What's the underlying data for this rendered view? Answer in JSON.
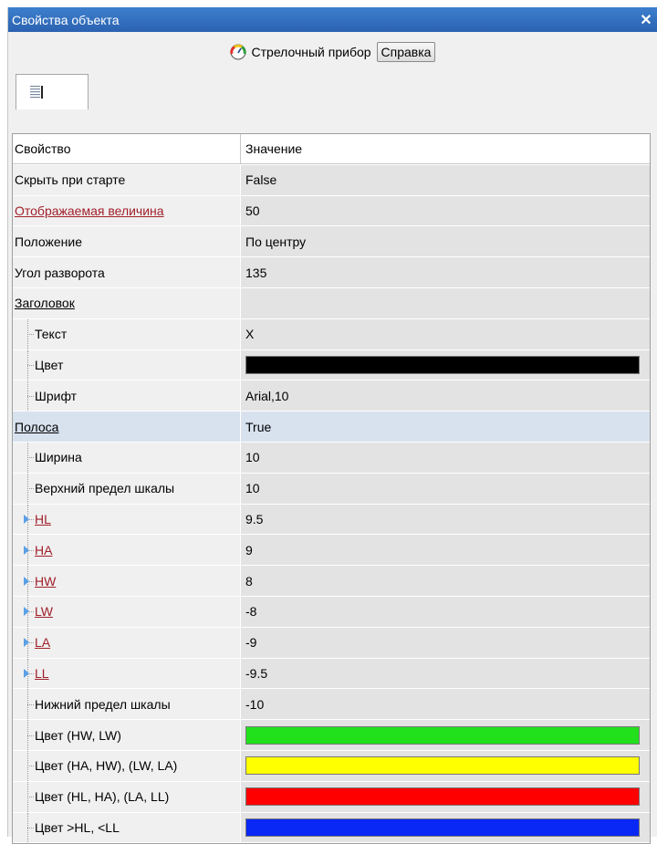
{
  "window": {
    "title": "Свойства объекта",
    "close_glyph": "✕"
  },
  "toolbar": {
    "object_type": "Стрелочный прибор",
    "help_label": "Справка",
    "icon": "gauge-icon"
  },
  "tab": {
    "icon": "property-list-icon"
  },
  "grid": {
    "header": {
      "name": "Свойство",
      "value": "Значение"
    },
    "rows": [
      {
        "name": "Скрыть при старте",
        "value": "False"
      },
      {
        "name": "Отображаемая величина",
        "value": "50"
      },
      {
        "name": "Положение",
        "value": "По центру"
      },
      {
        "name": "Угол разворота",
        "value": "135"
      },
      {
        "name": "Заголовок",
        "value": ""
      },
      {
        "name": "Текст",
        "value": "X"
      },
      {
        "name": "Цвет",
        "value": "",
        "color": "#000000"
      },
      {
        "name": "Шрифт",
        "value": "Arial,10"
      },
      {
        "name": "Полоса",
        "value": "True"
      },
      {
        "name": "Ширина",
        "value": "10"
      },
      {
        "name": "Верхний предел шкалы",
        "value": "10"
      },
      {
        "name": "HL",
        "value": "9.5"
      },
      {
        "name": "HA",
        "value": "9"
      },
      {
        "name": "HW",
        "value": "8"
      },
      {
        "name": "LW",
        "value": "-8"
      },
      {
        "name": "LA",
        "value": "-9"
      },
      {
        "name": "LL",
        "value": "-9.5"
      },
      {
        "name": "Нижний предел шкалы",
        "value": "-10"
      },
      {
        "name": "Цвет (HW, LW)",
        "value": "",
        "color": "#22e01c"
      },
      {
        "name": "Цвет (HA, HW), (LW, LA)",
        "value": "",
        "color": "#ffff00"
      },
      {
        "name": "Цвет (HL, HA), (LA, LL)",
        "value": "",
        "color": "#ff0000"
      },
      {
        "name": "Цвет >HL, <LL",
        "value": "",
        "color": "#0a28f5"
      }
    ]
  },
  "colors": {
    "title_bar": "#2f6fbf",
    "link_red": "#a0202a",
    "selected_row": "#d8e2ef"
  }
}
